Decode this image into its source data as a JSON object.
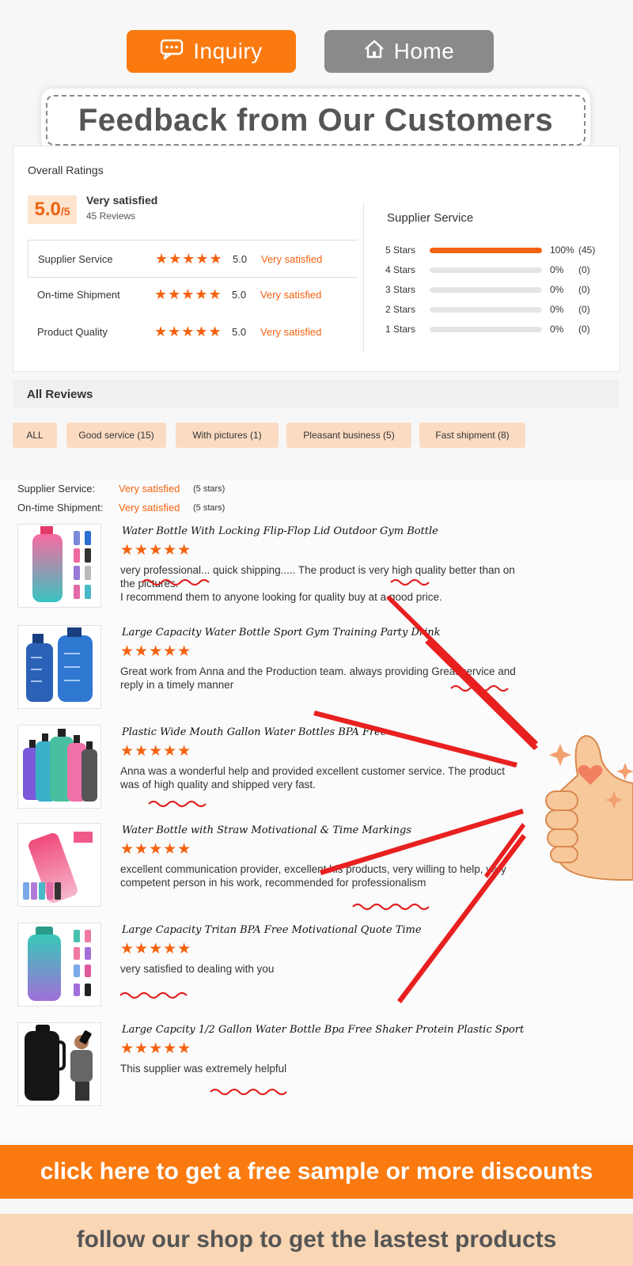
{
  "top_buttons": {
    "inquiry": "Inquiry",
    "home": "Home"
  },
  "page_title": "Feedback from Our Customers",
  "overall": {
    "heading": "Overall Ratings",
    "score": "5.0",
    "score_max": "/5",
    "summary": "Very satisfied",
    "review_count": "45 Reviews",
    "sub_ratings": [
      {
        "name": "Supplier Service",
        "stars": "★★★★★",
        "value": "5.0",
        "status": "Very satisfied"
      },
      {
        "name": "On-time Shipment",
        "stars": "★★★★★",
        "value": "5.0",
        "status": "Very satisfied"
      },
      {
        "name": "Product Quality",
        "stars": "★★★★★",
        "value": "5.0",
        "status": "Very satisfied"
      }
    ],
    "distribution_title": "Supplier Service",
    "distribution": [
      {
        "label": "5 Stars",
        "fraction": 1.0,
        "percent": "100%",
        "count": "(45)"
      },
      {
        "label": "4 Stars",
        "fraction": 0.0,
        "percent": "0%",
        "count": "(0)"
      },
      {
        "label": "3 Stars",
        "fraction": 0.0,
        "percent": "0%",
        "count": "(0)"
      },
      {
        "label": "2 Stars",
        "fraction": 0.0,
        "percent": "0%",
        "count": "(0)"
      },
      {
        "label": "1 Stars",
        "fraction": 0.0,
        "percent": "0%",
        "count": "(0)"
      }
    ]
  },
  "all_reviews": {
    "heading": "All Reviews",
    "filters": [
      "ALL",
      "Good service (15)",
      "With pictures (1)",
      "Pleasant business (5)",
      "Fast shipment (8)"
    ]
  },
  "summary_rows": [
    {
      "key": "Supplier Service:",
      "value": "Very satisfied",
      "stars": "(5 stars)"
    },
    {
      "key": "On-time Shipment:",
      "value": "Very satisfied",
      "stars": "(5 stars)"
    }
  ],
  "reviews": [
    {
      "title": "Water Bottle With Locking Flip-Flop Lid Outdoor Gym Bottle",
      "stars": "★★★★★",
      "text": "very professional... quick shipping..... The product is very high quality better than on the pictures.\nI recommend them to anyone looking for quality buy at a good price."
    },
    {
      "title": "Large Capacity Water Bottle Sport Gym Training Party Drink",
      "stars": "★★★★★",
      "text": "Great work from Anna and the Production team. always providing Great service and reply in a timely manner"
    },
    {
      "title": "Plastic Wide Mouth Gallon Water Bottles BPA Free",
      "stars": "★★★★★",
      "text": "Anna was a wonderful help and provided excellent customer service. The product was of high quality and shipped very fast."
    },
    {
      "title": "Water Bottle with Straw Motivational & Time Markings",
      "stars": "★★★★★",
      "text": "excellent communication provider, excellent his products, very willing to help, very competent person in his work, recommended for professionalism"
    },
    {
      "title": "Large Capacity Tritan BPA Free Motivational Quote Time",
      "stars": "★★★★★",
      "text": "very satisfied to dealing with you"
    },
    {
      "title": "Large Capcity 1/2 Gallon Water Bottle Bpa Free Shaker Protein Plastic Sport",
      "stars": "★★★★★",
      "text": "This supplier was extremely helpful"
    }
  ],
  "banners": {
    "sample": "click here to get a free sample or more discounts",
    "follow": "follow our shop to get the lastest products"
  },
  "colors": {
    "accent": "#fa7a10",
    "star": "#f5620f",
    "chip": "#fbdcc3",
    "arrow": "#e82020"
  }
}
